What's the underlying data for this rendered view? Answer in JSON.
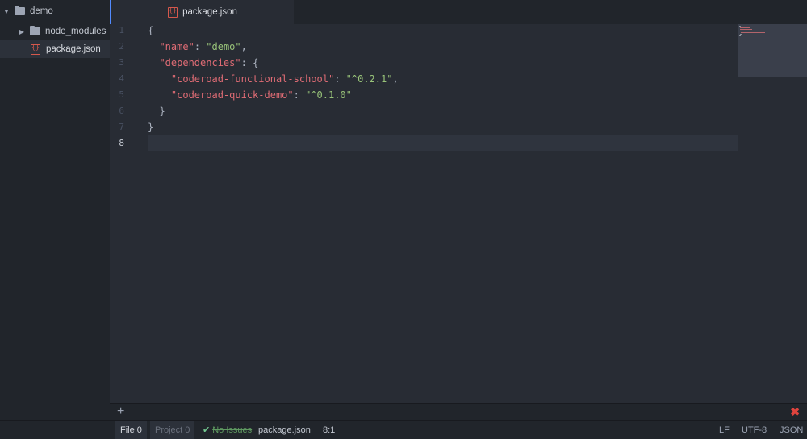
{
  "tree": {
    "root": {
      "label": "demo",
      "icon": "folder-icon",
      "expanded": true
    },
    "items": [
      {
        "label": "node_modules",
        "icon": "folder-icon",
        "expanded": false
      },
      {
        "label": "package.json",
        "icon": "json-file-icon",
        "selected": true
      }
    ]
  },
  "tabs": [
    {
      "label": "package.json",
      "icon": "json-file-icon",
      "active": true
    }
  ],
  "editor": {
    "line_numbers": [
      "1",
      "2",
      "3",
      "4",
      "5",
      "6",
      "7",
      "8"
    ],
    "active_line": "8",
    "lines": [
      {
        "punct_open": "{"
      },
      {
        "indent": "  ",
        "key": "\"name\"",
        "sep": ": ",
        "value": "\"demo\"",
        "end": ","
      },
      {
        "indent": "  ",
        "key": "\"dependencies\"",
        "sep": ": ",
        "end": "{"
      },
      {
        "indent": "    ",
        "key": "\"coderoad-functional-school\"",
        "sep": ": ",
        "value": "\"^0.2.1\"",
        "end": ","
      },
      {
        "indent": "    ",
        "key": "\"coderoad-quick-demo\"",
        "sep": ": ",
        "value": "\"^0.1.0\"",
        "end": ""
      },
      {
        "indent": "  ",
        "punct_close": "}"
      },
      {
        "punct_close": "}"
      },
      {}
    ]
  },
  "panel": {
    "add_icon": "plus-icon",
    "close_icon": "close-icon"
  },
  "status": {
    "file_tab": "File 0",
    "project_tab": "Project 0",
    "lint_icon": "checkmark-icon",
    "lint_label": "No Issues",
    "filename": "package.json",
    "cursor": "8:1",
    "line_ending": "LF",
    "encoding": "UTF-8",
    "grammar": "JSON"
  },
  "colors": {
    "accent": "#528bff",
    "key": "#e06c75",
    "string": "#98c379",
    "error": "#e0443e"
  }
}
